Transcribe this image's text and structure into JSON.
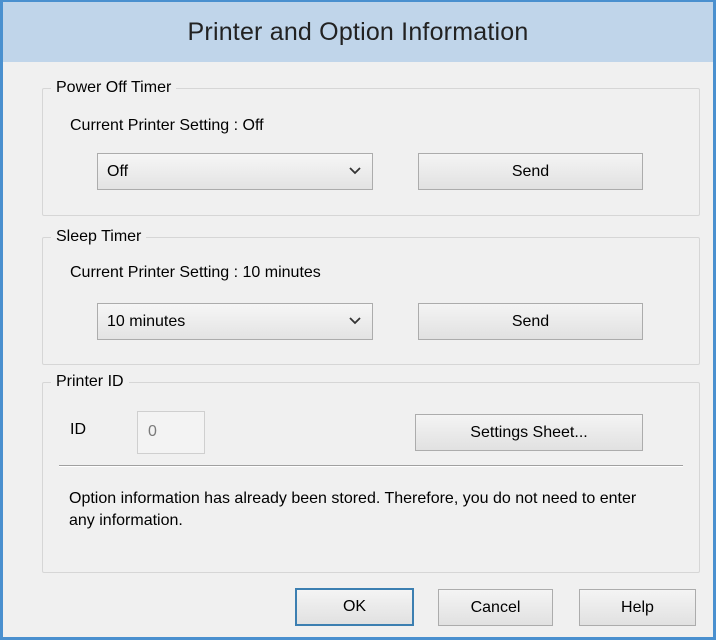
{
  "window": {
    "title": "Printer and Option Information"
  },
  "power_off_timer": {
    "group_label": "Power Off Timer",
    "current_setting_text": "Current Printer Setting : Off",
    "selected_value": "Off",
    "send_label": "Send"
  },
  "sleep_timer": {
    "group_label": "Sleep Timer",
    "current_setting_text": "Current Printer Setting : 10 minutes",
    "selected_value": "10 minutes",
    "send_label": "Send"
  },
  "printer_id": {
    "group_label": "Printer ID",
    "id_label": "ID",
    "id_value": "0",
    "settings_sheet_label": "Settings Sheet...",
    "info_message": "Option information has already been stored. Therefore, you do not need to enter any information."
  },
  "footer": {
    "ok_label": "OK",
    "cancel_label": "Cancel",
    "help_label": "Help"
  },
  "icons": {
    "dropdown": "chevron-down-icon"
  },
  "colors": {
    "titlebar": "#c0d5ea",
    "window_border": "#4a90cf",
    "default_button_border": "#3c7fb1"
  }
}
